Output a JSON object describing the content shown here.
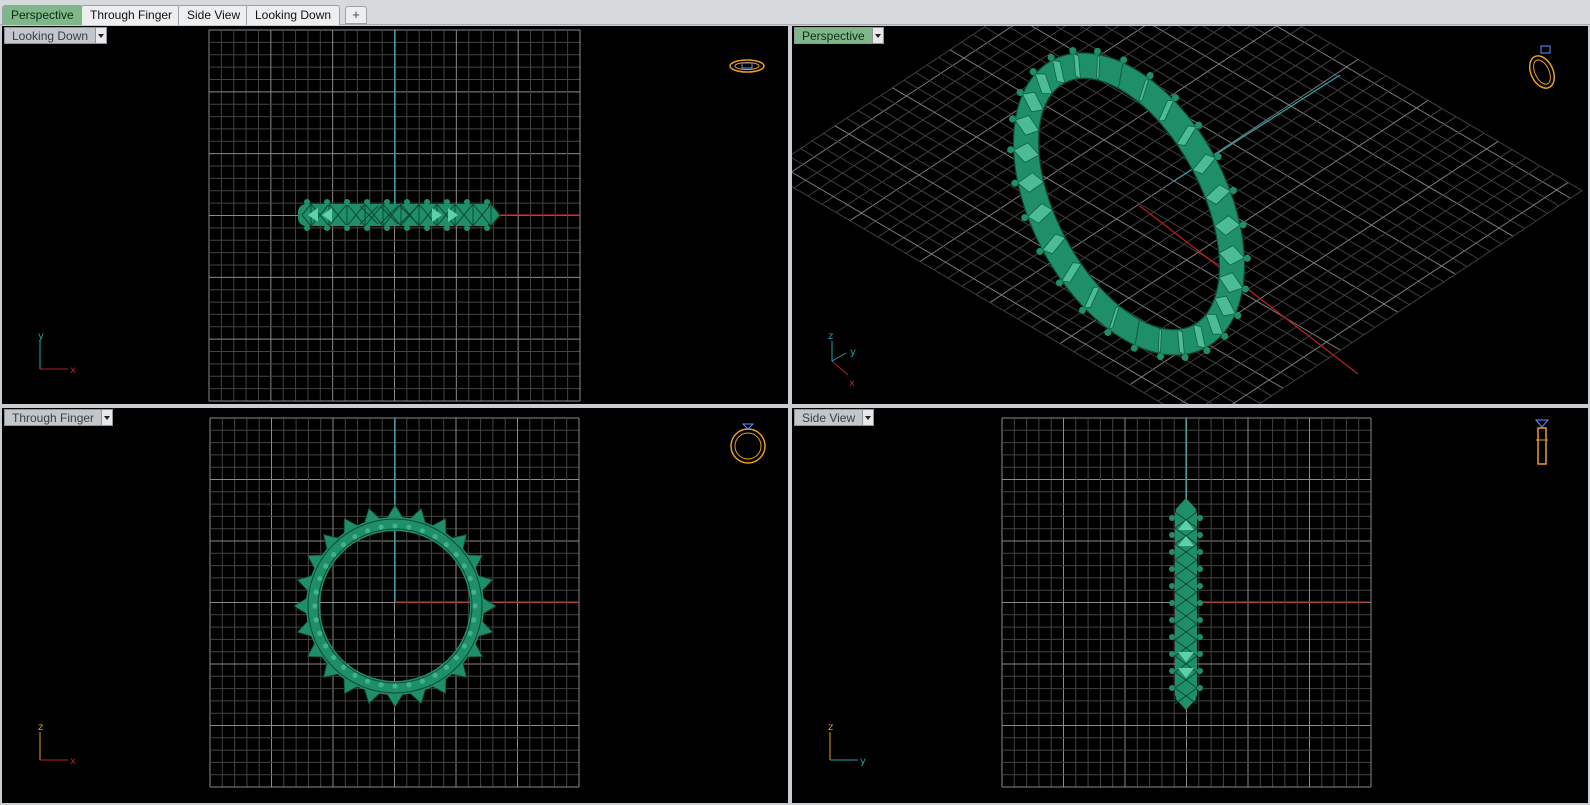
{
  "tabs": [
    {
      "label": "Perspective",
      "active": true
    },
    {
      "label": "Through Finger",
      "active": false
    },
    {
      "label": "Side View",
      "active": false
    },
    {
      "label": "Looking Down",
      "active": false
    }
  ],
  "add_tab_icon": "plus-icon",
  "viewports": {
    "top": {
      "label": "Looking Down",
      "axis_v": "y",
      "axis_h": "x"
    },
    "persp": {
      "label": "Perspective",
      "axis_v": "z",
      "axis_h": "x",
      "axis_d": "y"
    },
    "front": {
      "label": "Through Finger",
      "axis_v": "z",
      "axis_h": "x"
    },
    "side": {
      "label": "Side View",
      "axis_v": "z",
      "axis_h": "y"
    }
  },
  "colors": {
    "model": "#1f8f6a",
    "model_light": "#5fd0a8",
    "grid": "#5a5a5a",
    "axis_x": "#b52020",
    "axis_y": "#2aa0a8",
    "widget": "#e8a020",
    "active_tab": "#7fb68a"
  }
}
